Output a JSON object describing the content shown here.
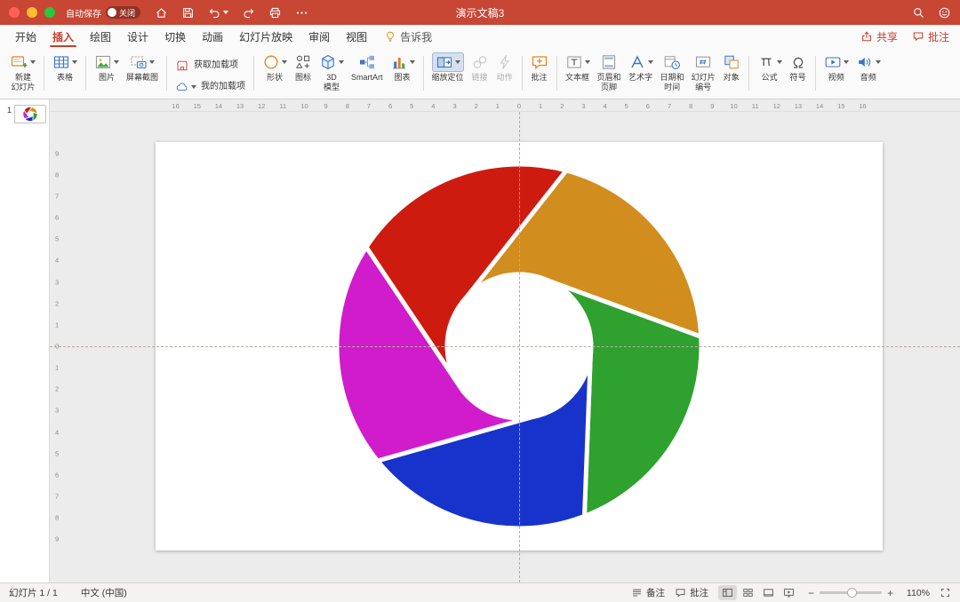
{
  "titlebar": {
    "title": "演示文稿3",
    "autosave": {
      "label": "自动保存",
      "state": "关闭"
    },
    "icons": [
      {
        "id": "home",
        "icon": "home"
      },
      {
        "id": "save",
        "icon": "save"
      },
      {
        "id": "undo",
        "icon": "undo",
        "dropdown": true
      },
      {
        "id": "redo",
        "icon": "redo"
      },
      {
        "id": "print",
        "icon": "print"
      },
      {
        "id": "more",
        "icon": "more"
      }
    ],
    "right_icons": [
      {
        "id": "search",
        "icon": "search"
      },
      {
        "id": "feedback",
        "icon": "smiley"
      }
    ]
  },
  "tabbar": {
    "tabs": [
      {
        "id": "home",
        "label": "开始"
      },
      {
        "id": "insert",
        "label": "插入",
        "selected": true
      },
      {
        "id": "draw",
        "label": "绘图"
      },
      {
        "id": "design",
        "label": "设计"
      },
      {
        "id": "transitions",
        "label": "切换"
      },
      {
        "id": "animations",
        "label": "动画"
      },
      {
        "id": "slideshow",
        "label": "幻灯片放映"
      },
      {
        "id": "review",
        "label": "审阅"
      },
      {
        "id": "view",
        "label": "视图"
      }
    ],
    "tellme": "告诉我",
    "actions": [
      {
        "id": "share",
        "label": "共享",
        "icon": "share"
      },
      {
        "id": "comments",
        "label": "批注",
        "icon": "commenttab"
      }
    ]
  },
  "ribbon": {
    "groups": [
      {
        "items": [
          {
            "id": "new-slide",
            "label": "新建\n幻灯片",
            "icon": "newslide",
            "dropdown": true
          }
        ]
      },
      {
        "items": [
          {
            "id": "table",
            "label": "表格",
            "icon": "table",
            "dropdown": true
          }
        ]
      },
      {
        "items": [
          {
            "id": "pictures",
            "label": "图片",
            "icon": "picture",
            "dropdown": true
          },
          {
            "id": "screenshot",
            "label": "屏幕截图",
            "icon": "screenshot",
            "dropdown": true
          }
        ]
      },
      {
        "stacked": true,
        "items": [
          {
            "id": "get-add-ins",
            "label": "获取加载项",
            "icon": "store"
          },
          {
            "id": "my-add-ins",
            "label": "我的加载项",
            "icon": "cloud",
            "dropdown": true
          }
        ]
      },
      {
        "items": [
          {
            "id": "shapes",
            "label": "形状",
            "icon": "shapes",
            "dropdown": true
          },
          {
            "id": "icons",
            "label": "图标",
            "icon": "iconset"
          },
          {
            "id": "3d-models",
            "label": "3D\n模型",
            "icon": "cube",
            "dropdown": true
          },
          {
            "id": "smartart",
            "label": "SmartArt",
            "icon": "smartart"
          },
          {
            "id": "chart",
            "label": "图表",
            "icon": "chart",
            "dropdown": true
          }
        ]
      },
      {
        "items": [
          {
            "id": "zoom",
            "label": "缩放定位",
            "icon": "zoomsec",
            "dropdown": true,
            "highlight": true
          },
          {
            "id": "link",
            "label": "链接",
            "icon": "link",
            "disabled": true
          },
          {
            "id": "action",
            "label": "动作",
            "icon": "action",
            "disabled": true
          }
        ]
      },
      {
        "items": [
          {
            "id": "comment",
            "label": "批注",
            "icon": "commentadd"
          }
        ]
      },
      {
        "items": [
          {
            "id": "text-box",
            "label": "文本框",
            "icon": "textbox",
            "dropdown": true
          },
          {
            "id": "header-footer",
            "label": "页眉和\n页脚",
            "icon": "headfoot"
          },
          {
            "id": "wordart",
            "label": "艺术字",
            "icon": "wordart",
            "dropdown": true
          },
          {
            "id": "date-time",
            "label": "日期和\n时间",
            "icon": "datetime"
          },
          {
            "id": "slide-number",
            "label": "幻灯片\n编号",
            "icon": "slidenum"
          },
          {
            "id": "object",
            "label": "对象",
            "icon": "object"
          }
        ]
      },
      {
        "items": [
          {
            "id": "equation",
            "label": "公式",
            "icon": "equation",
            "dropdown": true
          },
          {
            "id": "symbol",
            "label": "符号",
            "icon": "symbol"
          }
        ]
      },
      {
        "items": [
          {
            "id": "video",
            "label": "视频",
            "icon": "video",
            "dropdown": true
          },
          {
            "id": "audio",
            "label": "音频",
            "icon": "audio",
            "dropdown": true
          }
        ]
      }
    ]
  },
  "slidepanel": {
    "slides": [
      {
        "number": "1"
      }
    ]
  },
  "rulers": {
    "horizontal_labels": [
      16,
      15,
      14,
      13,
      12,
      11,
      10,
      9,
      8,
      7,
      6,
      5,
      4,
      3,
      2,
      1,
      0,
      1,
      2,
      3,
      4,
      5,
      6,
      7,
      8,
      9,
      10,
      11,
      12,
      13,
      14,
      15,
      16
    ],
    "vertical_labels": [
      9,
      8,
      7,
      6,
      5,
      4,
      3,
      2,
      1,
      0,
      1,
      2,
      3,
      4,
      5,
      6,
      7,
      8,
      9
    ]
  },
  "canvas": {
    "shutter": {
      "span_deg": 72,
      "segments": [
        {
          "name": "red",
          "color": "#ce1b10",
          "start_deg": -57
        },
        {
          "name": "amber",
          "color": "#d18d1d",
          "start_deg": 15
        },
        {
          "name": "green",
          "color": "#2ea12e",
          "start_deg": 87
        },
        {
          "name": "blue",
          "color": "#1733cb",
          "start_deg": 159
        },
        {
          "name": "magenta",
          "color": "#d01ccb",
          "start_deg": 231
        }
      ]
    }
  },
  "statusbar": {
    "slide_indicator": "幻灯片 1 / 1",
    "language": "中文 (中国)",
    "notes_label": "备注",
    "comments_label": "批注",
    "zoom_out": "−",
    "zoom_in": "+",
    "zoom_level": "110%"
  }
}
